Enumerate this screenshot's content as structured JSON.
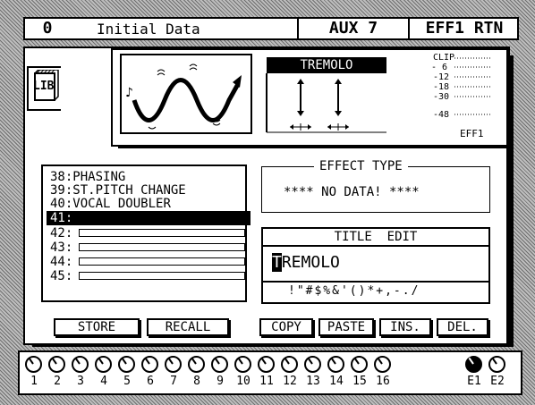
{
  "header": {
    "scene_number": "0",
    "scene_name": "Initial Data",
    "bus": "AUX 7",
    "return": "EFF1 RTN"
  },
  "lib_tab": {
    "label": "LIB"
  },
  "effect_display": {
    "name": "TREMOLO",
    "meter_labels": [
      "CLIP",
      "- 6",
      "-12",
      "-18",
      "-30",
      "-48"
    ],
    "meter_channel": "EFF1"
  },
  "library_list": {
    "items": [
      {
        "number": "38",
        "name": "PHASING"
      },
      {
        "number": "39",
        "name": "ST.PITCH CHANGE"
      },
      {
        "number": "40",
        "name": "VOCAL DOUBLER"
      },
      {
        "number": "41",
        "name": "",
        "selected": true
      },
      {
        "number": "42",
        "name": ""
      },
      {
        "number": "43",
        "name": ""
      },
      {
        "number": "44",
        "name": ""
      },
      {
        "number": "45",
        "name": ""
      }
    ]
  },
  "effect_type": {
    "title": "EFFECT TYPE",
    "value": "**** NO DATA! ****"
  },
  "title_edit": {
    "title": "TITLE  EDIT",
    "cursor_char": "T",
    "value_rest": "REMOLO",
    "charset": "!\"#$%&'()*+,-./"
  },
  "buttons": {
    "store": "STORE",
    "recall": "RECALL",
    "copy": "COPY",
    "paste": "PASTE",
    "ins": "INS.",
    "del": "DEL."
  },
  "channels": {
    "labels": [
      "1",
      "2",
      "3",
      "4",
      "5",
      "6",
      "7",
      "8",
      "9",
      "10",
      "11",
      "12",
      "13",
      "14",
      "15",
      "16"
    ],
    "effect_labels": [
      "E1",
      "E2"
    ]
  }
}
